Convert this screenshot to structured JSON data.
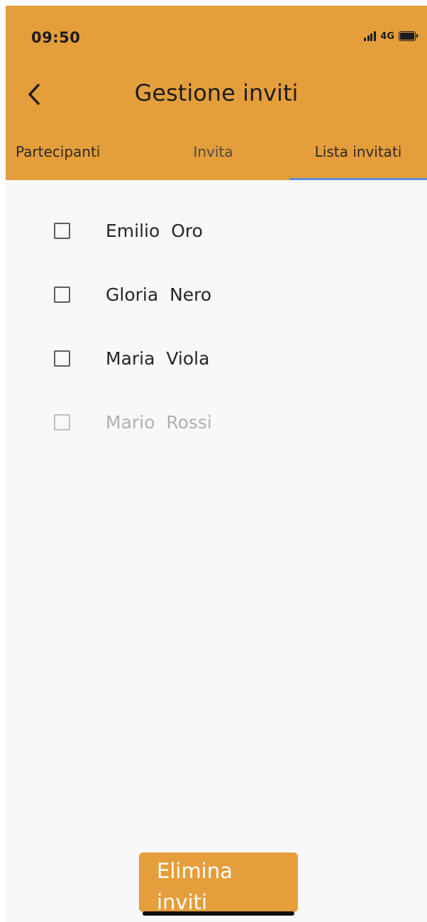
{
  "status_bar": {
    "time": "09:50",
    "network": "4G"
  },
  "header": {
    "title": "Gestione inviti",
    "back_icon": "chevron-left-icon",
    "background_color": "#e49e3b"
  },
  "tabs": [
    {
      "label": "Partecipanti",
      "active": false
    },
    {
      "label": "Invita",
      "active": false
    },
    {
      "label": "Lista invitati",
      "active": true
    }
  ],
  "invitees": [
    {
      "first_name": "Emilio",
      "last_name": "Oro",
      "checked": false,
      "enabled": true
    },
    {
      "first_name": "Gloria",
      "last_name": "Nero",
      "checked": false,
      "enabled": true
    },
    {
      "first_name": "Maria",
      "last_name": "Viola",
      "checked": false,
      "enabled": true
    },
    {
      "first_name": "Mario",
      "last_name": "Rossi",
      "checked": false,
      "enabled": false
    }
  ],
  "actions": {
    "delete_label_line1": "Elimina",
    "delete_label_line2": "inviti"
  },
  "colors": {
    "accent": "#e49e3b",
    "tab_indicator": "#5b8fd6",
    "background": "#f8f8f8"
  }
}
